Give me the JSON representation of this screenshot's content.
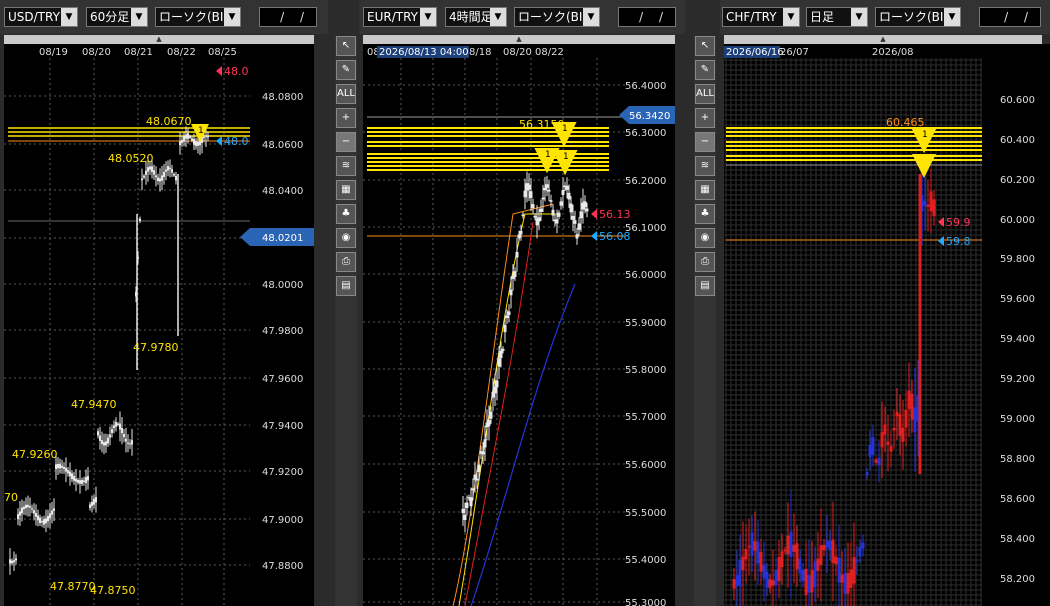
{
  "panels": [
    {
      "pair": "USD/TRY",
      "interval": "60分足",
      "chart_type": "ローソク(BID)",
      "date_input": "/ /",
      "x_ticks": [
        "08/19",
        "08/20",
        "08/21",
        "08/22",
        "08/25"
      ],
      "y_ticks": [
        "48.0800",
        "48.0600",
        "48.0400",
        "48.0200",
        "48.0000",
        "47.9800",
        "47.9600",
        "47.9400",
        "47.9200",
        "47.9000",
        "47.8800"
      ],
      "current_price": "48.0201",
      "ask_label": "48.0",
      "bid_label": "48.0",
      "annotations": [
        "48.0670",
        "48.0520",
        "47.9780",
        "47.9470",
        "47.9260",
        "47.8770",
        "47.8750",
        "70"
      ],
      "alert_marker": "1"
    },
    {
      "pair": "EUR/TRY",
      "interval": "4時間足",
      "chart_type": "ローソク(BID)",
      "date_input": "/ /",
      "x_ticks_prefix": "08",
      "crosshair_date": "2026/08/13 04:00",
      "x_ticks": [
        "8/18",
        "08/20",
        "08/22"
      ],
      "y_ticks": [
        "56.4000",
        "56.3000",
        "56.2000",
        "56.1000",
        "56.0000",
        "55.9000",
        "55.8000",
        "55.7000",
        "55.6000",
        "55.5000",
        "55.4000",
        "55.3000"
      ],
      "current_price": "56.3420",
      "ask_label": "56.13",
      "bid_label": "56.08",
      "annotations": [
        "56.3150"
      ],
      "alert_marker": "1"
    },
    {
      "pair": "CHF/TRY",
      "interval": "日足",
      "chart_type": "ローソク(BID)",
      "date_input": "/ /",
      "crosshair_date": "2026/06/16",
      "x_ticks": [
        "26/07",
        "2026/08"
      ],
      "y_ticks": [
        "60.600",
        "60.400",
        "60.200",
        "60.000",
        "59.800",
        "59.600",
        "59.400",
        "59.200",
        "59.000",
        "58.800",
        "58.600",
        "58.400",
        "58.200"
      ],
      "ask_label": "59.9",
      "bid_label": "59.8",
      "annotations": [
        "60.465"
      ],
      "alert_marker": "1"
    }
  ],
  "tools": [
    {
      "name": "pointer-tool",
      "glyph": "↖"
    },
    {
      "name": "pen-tool",
      "glyph": "✎"
    },
    {
      "name": "erase-all-tool",
      "glyph": "ALL"
    },
    {
      "name": "zoom-in-tool",
      "glyph": "+"
    },
    {
      "name": "zoom-out-tool",
      "glyph": "−"
    },
    {
      "name": "indicator-tool",
      "glyph": "≋"
    },
    {
      "name": "data-tool",
      "glyph": "▦"
    },
    {
      "name": "symbols-tool",
      "glyph": "♣"
    },
    {
      "name": "view-tool",
      "glyph": "◉"
    },
    {
      "name": "print-tool",
      "glyph": "⎙"
    },
    {
      "name": "table-tool",
      "glyph": "▤"
    }
  ],
  "colors": {
    "ask": "#ff3355",
    "bid": "#22aaff",
    "price_box": "#2a64b4",
    "yellow": "#ffe400",
    "orange": "#ff8c1a",
    "candle_white": "#e8e8e8",
    "candle_red": "#e02020",
    "candle_blue": "#2433d8"
  }
}
